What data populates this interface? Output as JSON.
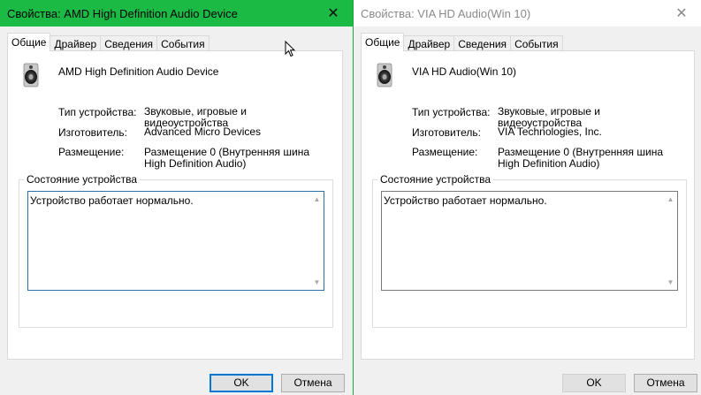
{
  "left_window": {
    "title": "Свойства: AMD High Definition Audio Device",
    "tabs": [
      "Общие",
      "Драйвер",
      "Сведения",
      "События"
    ],
    "device_name": "AMD High Definition Audio Device",
    "properties": [
      {
        "label": "Тип устройства:",
        "value": "Звуковые, игровые и видеоустройства"
      },
      {
        "label": "Изготовитель:",
        "value": "Advanced Micro Devices"
      },
      {
        "label": "Размещение:",
        "value": "Размещение 0 (Внутренняя шина High Definition Audio)"
      }
    ],
    "status_group_title": "Состояние устройства",
    "status_text": "Устройство работает нормально.",
    "ok_label": "OK",
    "cancel_label": "Отмена"
  },
  "right_window": {
    "title": "Свойства: VIA HD Audio(Win 10)",
    "tabs": [
      "Общие",
      "Драйвер",
      "Сведения",
      "События"
    ],
    "device_name": "VIA HD Audio(Win 10)",
    "properties": [
      {
        "label": "Тип устройства:",
        "value": "Звуковые, игровые и видеоустройства"
      },
      {
        "label": "Изготовитель:",
        "value": "VIA Technologies, Inc."
      },
      {
        "label": "Размещение:",
        "value": "Размещение 0 (Внутренняя шина High Definition Audio)"
      }
    ],
    "status_group_title": "Состояние устройства",
    "status_text": "Устройство работает нормально.",
    "ok_label": "OK",
    "cancel_label": "Отмена"
  },
  "icons": {
    "close": "close-icon",
    "device": "speaker-icon",
    "scroll_up": "scroll-up-icon",
    "scroll_down": "scroll-down-icon",
    "cursor": "mouse-pointer-icon"
  },
  "colors": {
    "active_titlebar": "#1bba45",
    "inactive_titlebar": "#ffffff",
    "primary_button_border": "#0078d7",
    "focus_border": "#2f6fa3"
  }
}
